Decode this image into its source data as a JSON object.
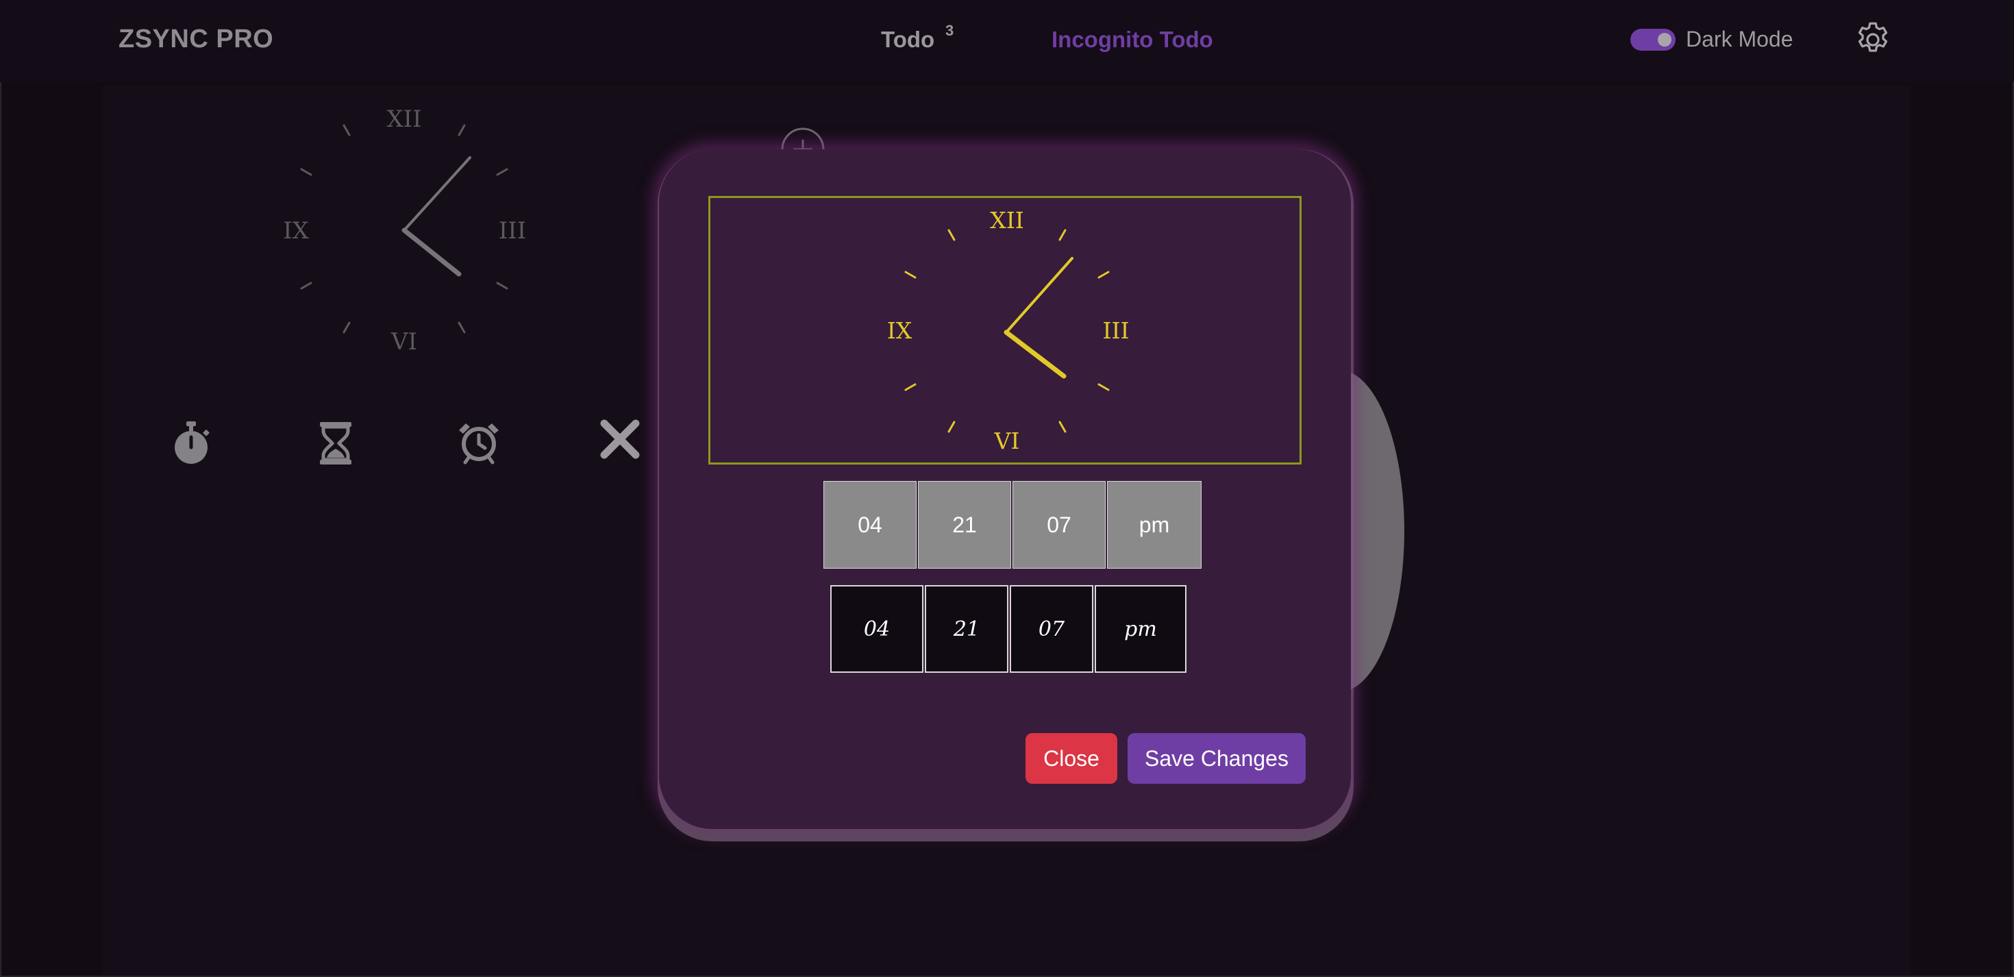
{
  "app": {
    "brand": "ZSYNC PRO"
  },
  "nav": {
    "todo_label": "Todo",
    "todo_count": "3",
    "incognito_label": "Incognito Todo"
  },
  "dark_mode": {
    "label": "Dark Mode",
    "enabled": true
  },
  "colors": {
    "accent": "#6f3ea4",
    "danger": "#dc3545",
    "clock_gold": "#e2c92a",
    "modal_bg": "#371c3b",
    "page_bg": "#120b13"
  },
  "background_clock": {
    "numerals": [
      "XII",
      "III",
      "VI",
      "IX"
    ],
    "time": {
      "hour": 4,
      "minute": 7
    }
  },
  "toolbar": {
    "icons": [
      "stopwatch-icon",
      "hourglass-icon",
      "alarm-clock-icon",
      "close-icon"
    ]
  },
  "modal": {
    "clock": {
      "numerals": [
        "XII",
        "III",
        "VI",
        "IX"
      ],
      "time": {
        "hour": 4,
        "minute": 7
      }
    },
    "time_inputs": [
      "04",
      "21",
      "07",
      "pm"
    ],
    "time_display": [
      "04",
      "21",
      "07",
      "pm"
    ],
    "close_label": "Close",
    "save_label": "Save Changes"
  }
}
